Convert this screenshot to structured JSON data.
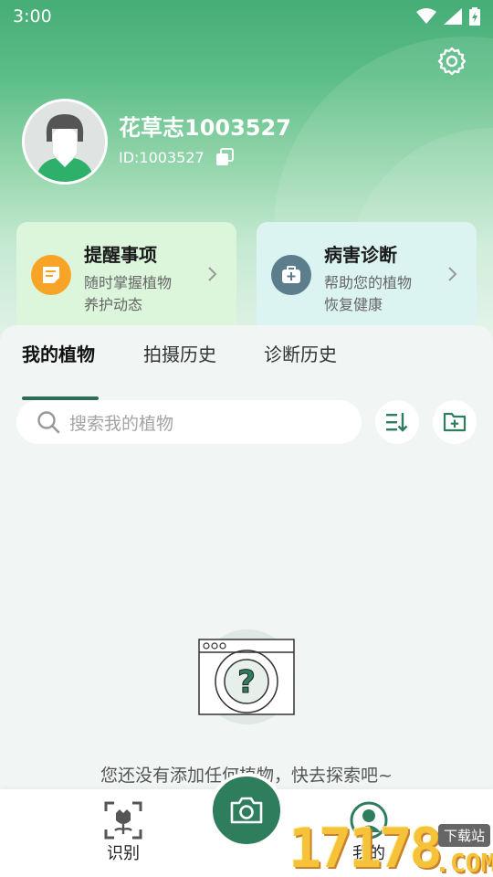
{
  "status_bar": {
    "time": "3:00"
  },
  "profile": {
    "username": "花草志1003527",
    "user_id": "ID:1003527"
  },
  "cards": {
    "reminder": {
      "title": "提醒事项",
      "subtitle": "随时掌握植物养护动态"
    },
    "diagnosis": {
      "title": "病害诊断",
      "subtitle": "帮助您的植物恢复健康"
    }
  },
  "tabs": [
    {
      "label": "我的植物",
      "active": true
    },
    {
      "label": "拍摄历史",
      "active": false
    },
    {
      "label": "诊断历史",
      "active": false
    }
  ],
  "search": {
    "placeholder": "搜索我的植物"
  },
  "empty_state": {
    "message": "您还没有添加任何植物，快去探索吧~"
  },
  "bottom_nav": {
    "identify_label": "识别",
    "mine_label": "我的"
  },
  "watermark": {
    "number": "17178",
    "domain": ".COM",
    "tag": "下载站"
  },
  "colors": {
    "brand_green": "#2e7d5c",
    "reminder_icon": "#f7a427",
    "diagnosis_icon": "#5b7d8c",
    "tab_indicator": "#2d6b5b"
  },
  "icons": [
    "wifi-icon",
    "signal-icon",
    "battery-icon",
    "gear-icon",
    "copy-icon",
    "note-icon",
    "medical-kit-icon",
    "chevron-right-icon",
    "search-icon",
    "sort-icon",
    "add-folder-icon",
    "camera-icon",
    "scan-flower-icon",
    "user-icon"
  ]
}
